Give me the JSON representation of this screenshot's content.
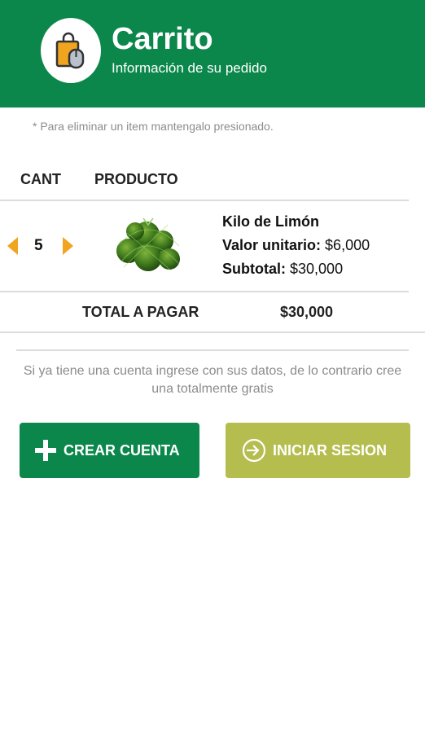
{
  "header": {
    "title": "Carrito",
    "subtitle": "Información de su pedido",
    "icon": "shopping-bag-icon",
    "background_color": "#0b874b"
  },
  "hint": "* Para eliminar un item mantengalo presionado.",
  "table": {
    "columns": [
      "CANT",
      "PRODUCTO"
    ],
    "items": [
      {
        "quantity": "5",
        "image": "limes-net-image",
        "name": "Kilo de Limón",
        "unit_price_label": "Valor unitario:",
        "unit_price": "$6,000",
        "subtotal_label": "Subtotal:",
        "subtotal": "$30,000"
      }
    ],
    "total_label": "TOTAL A PAGAR",
    "total_value": "$30,000"
  },
  "account_info": "Si ya tiene una cuenta ingrese con sus datos, de lo contrario cree una totalmente gratis",
  "buttons": {
    "create_account": {
      "label": "CREAR CUENTA",
      "icon": "plus-icon",
      "color": "#0b874b"
    },
    "login": {
      "label": "INICIAR SESION",
      "icon": "login-arrow-icon",
      "color": "#b5bd4f"
    }
  },
  "accent_color": "#f0a420"
}
